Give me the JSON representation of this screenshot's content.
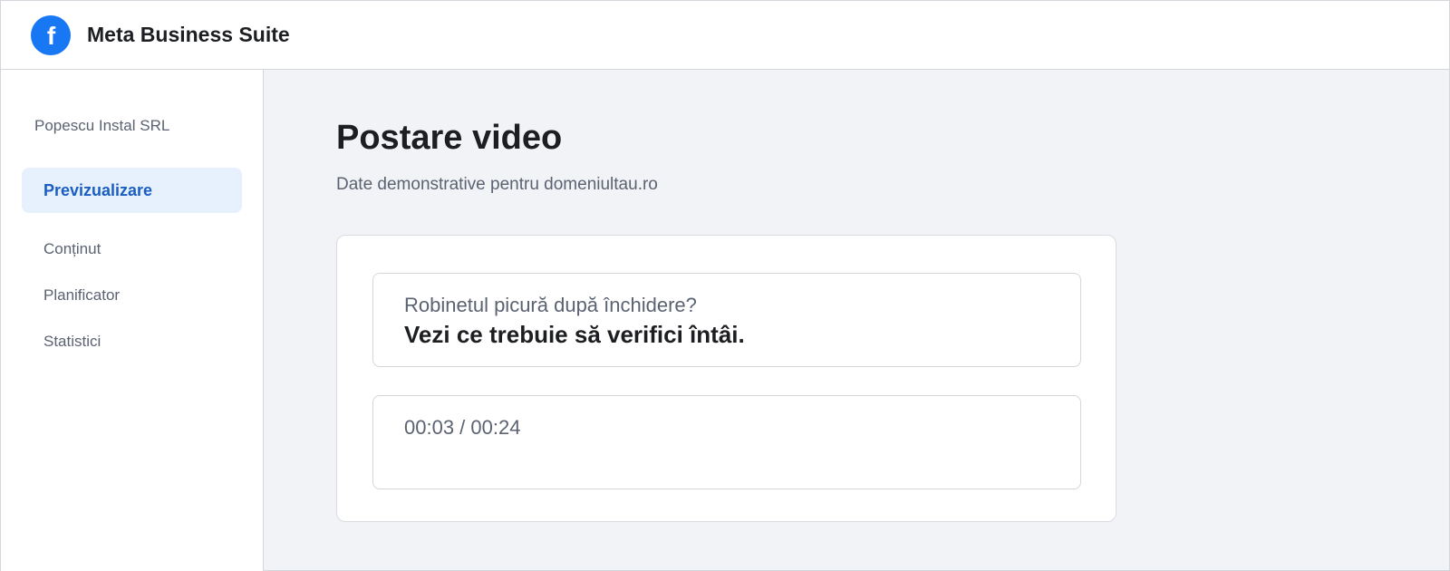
{
  "app": {
    "name": "Meta Business Suite",
    "logo_letter": "f",
    "brand_color": "#1877f2"
  },
  "sidebar": {
    "account_name": "Popescu Instal SRL",
    "items": [
      {
        "label": "Previzualizare",
        "active": true
      },
      {
        "label": "Conținut",
        "active": false
      },
      {
        "label": "Planificator",
        "active": false
      },
      {
        "label": "Statistici",
        "active": false
      }
    ],
    "active_color": "#1a5ec2"
  },
  "main": {
    "title": "Postare video",
    "subtitle": "Date demonstrative pentru domeniultau.ro",
    "caption": {
      "line1": "Robinetul picură după închidere?",
      "line2": "Vezi ce trebuie să verifici întâi."
    },
    "player": {
      "timecode": "00:03 / 00:24"
    }
  }
}
